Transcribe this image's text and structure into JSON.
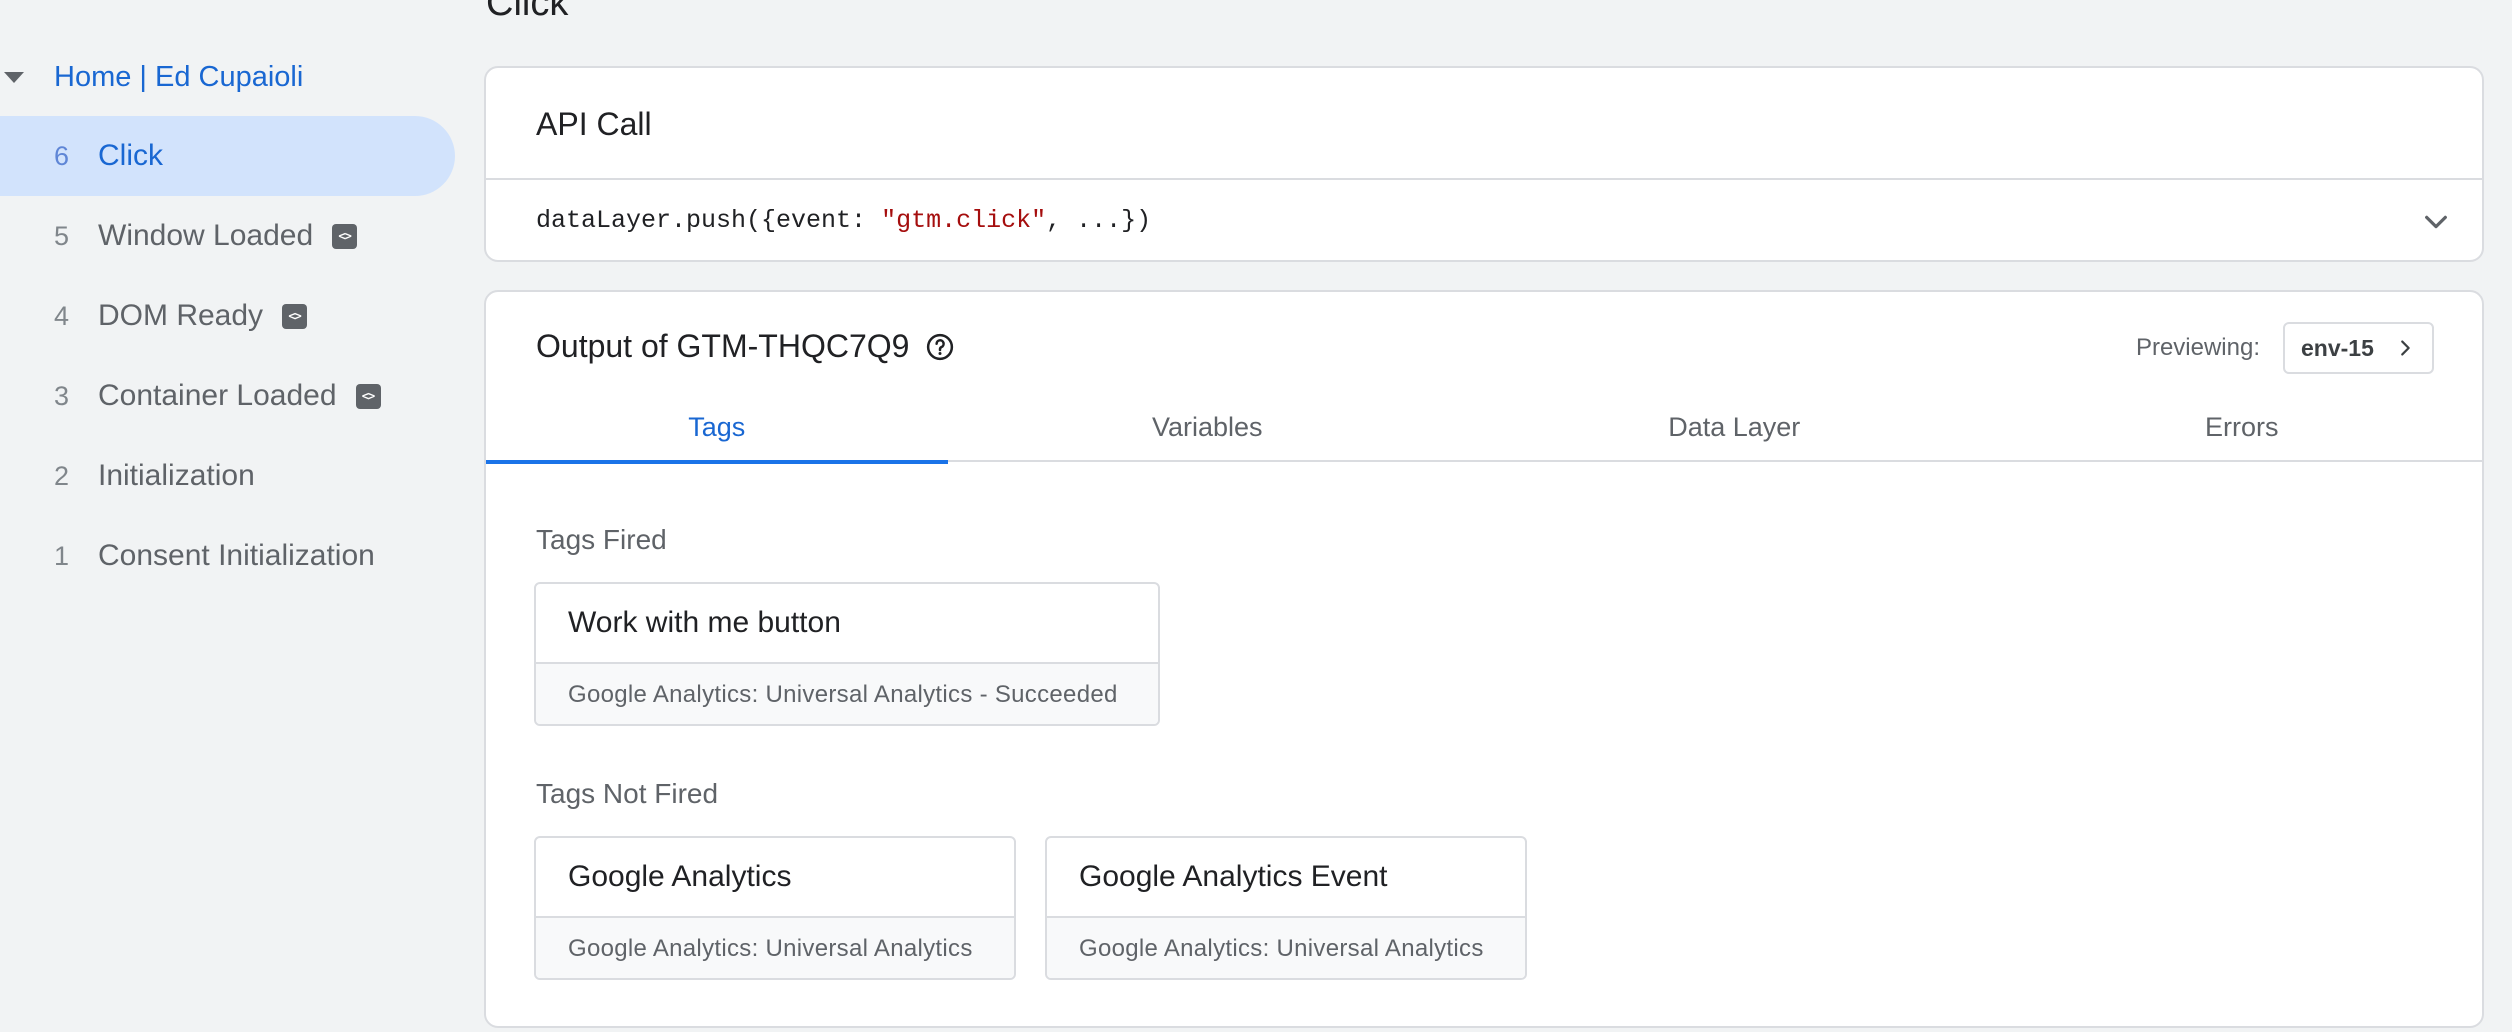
{
  "sidebar": {
    "page_title": "Home | Ed Cupaioli",
    "events": [
      {
        "num": "6",
        "label": "Click",
        "active": true,
        "badge": false
      },
      {
        "num": "5",
        "label": "Window Loaded",
        "active": false,
        "badge": true
      },
      {
        "num": "4",
        "label": "DOM Ready",
        "active": false,
        "badge": true
      },
      {
        "num": "3",
        "label": "Container Loaded",
        "active": false,
        "badge": true
      },
      {
        "num": "2",
        "label": "Initialization",
        "active": false,
        "badge": false
      },
      {
        "num": "1",
        "label": "Consent Initialization",
        "active": false,
        "badge": false
      }
    ]
  },
  "main": {
    "heading": "Click",
    "api_call": {
      "title": "API Call",
      "code_prefix": "dataLayer.push({event: ",
      "code_string": "\"gtm.click\"",
      "code_suffix": ", ...})"
    },
    "output": {
      "title": "Output of GTM-THQC7Q9",
      "previewing_label": "Previewing:",
      "env": "env-15",
      "tabs": [
        {
          "label": "Tags",
          "active": true
        },
        {
          "label": "Variables",
          "active": false
        },
        {
          "label": "Data Layer",
          "active": false
        },
        {
          "label": "Errors",
          "active": false
        }
      ],
      "tags_fired_label": "Tags Fired",
      "tags_fired": [
        {
          "name": "Work with me button",
          "type": "Google Analytics: Universal Analytics - Succeeded"
        }
      ],
      "tags_not_fired_label": "Tags Not Fired",
      "tags_not_fired": [
        {
          "name": "Google Analytics",
          "type": "Google Analytics: Universal Analytics"
        },
        {
          "name": "Google Analytics Event",
          "type": "Google Analytics: Universal Analytics"
        }
      ]
    }
  },
  "icons": {
    "expand": "chevron-down-icon",
    "help": "help-circle-icon",
    "env_arrow": "chevron-right-icon",
    "event_badge": "code-icon",
    "tree_toggle": "caret-down-icon"
  },
  "colors": {
    "accent": "#1a73e8",
    "active_bg": "#d2e3fc",
    "code_string": "#a50e0e",
    "background": "#f1f3f4"
  }
}
